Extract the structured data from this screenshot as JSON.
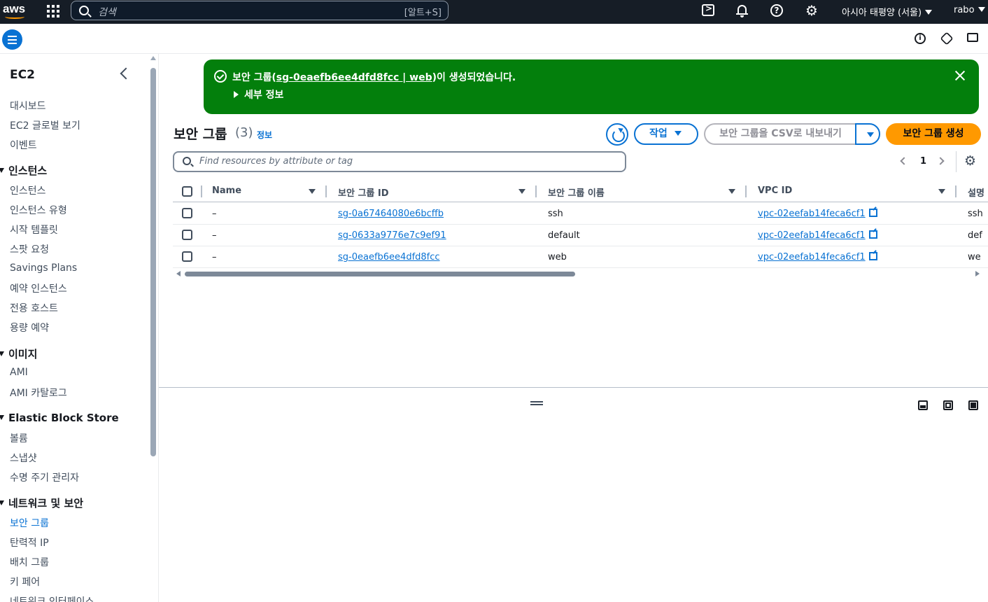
{
  "topnav": {
    "logo_text": "aws",
    "search_placeholder": "검색",
    "search_shortcut": "[알트+S]",
    "region": "아시아 태평양 (서울)",
    "user": "rabo"
  },
  "sidebar": {
    "title": "EC2",
    "items": [
      {
        "type": "item",
        "label": "대시보드"
      },
      {
        "type": "item",
        "label": "EC2 글로벌 보기"
      },
      {
        "type": "item",
        "label": "이벤트"
      },
      {
        "type": "section",
        "label": "인스턴스"
      },
      {
        "type": "item",
        "label": "인스턴스"
      },
      {
        "type": "item",
        "label": "인스턴스 유형"
      },
      {
        "type": "item",
        "label": "시작 템플릿"
      },
      {
        "type": "item",
        "label": "스팟 요청"
      },
      {
        "type": "item",
        "label": "Savings Plans"
      },
      {
        "type": "item",
        "label": "예약 인스턴스"
      },
      {
        "type": "item",
        "label": "전용 호스트"
      },
      {
        "type": "item",
        "label": "용량 예약"
      },
      {
        "type": "section",
        "label": "이미지"
      },
      {
        "type": "item",
        "label": "AMI"
      },
      {
        "type": "item",
        "label": "AMI 카탈로그"
      },
      {
        "type": "section",
        "label": "Elastic Block Store"
      },
      {
        "type": "item",
        "label": "볼륨"
      },
      {
        "type": "item",
        "label": "스냅샷"
      },
      {
        "type": "item",
        "label": "수명 주기 관리자"
      },
      {
        "type": "section",
        "label": "네트워크 및 보안"
      },
      {
        "type": "item",
        "label": "보안 그룹",
        "active": true
      },
      {
        "type": "item",
        "label": "탄력적 IP"
      },
      {
        "type": "item",
        "label": "배치 그룹"
      },
      {
        "type": "item",
        "label": "키 페어"
      },
      {
        "type": "item",
        "label": "네트워크 인터페이스"
      }
    ]
  },
  "flash": {
    "prefix": "보안 그룹(",
    "link": "sg-0eaefb6ee4dfd8fcc | web",
    "suffix": ")이 생성되었습니다.",
    "details": "세부 정보",
    "color": "#037f0c"
  },
  "header": {
    "title": "보안 그룹",
    "count": "(3)",
    "info": "정보",
    "action_label": "작업",
    "csv_label": "보안 그룹을 CSV로 내보내기",
    "create_label": "보안 그룹 생성",
    "accent": "#0972d3",
    "primary": "#ff9900"
  },
  "filter": {
    "placeholder": "Find resources by attribute or tag"
  },
  "pager": {
    "page": "1"
  },
  "table": {
    "columns": [
      "Name",
      "보안 그룹 ID",
      "보안 그룹 이름",
      "VPC ID",
      "설명"
    ],
    "rows": [
      {
        "name": "–",
        "sg_id": "sg-0a67464080e6bcffb",
        "sg_name": "ssh",
        "vpc_id": "vpc-02eefab14feca6cf1",
        "desc": "ssh"
      },
      {
        "name": "–",
        "sg_id": "sg-0633a9776e7c9ef91",
        "sg_name": "default",
        "vpc_id": "vpc-02eefab14feca6cf1",
        "desc": "def"
      },
      {
        "name": "–",
        "sg_id": "sg-0eaefb6ee4dfd8fcc",
        "sg_name": "web",
        "vpc_id": "vpc-02eefab14feca6cf1",
        "desc": "we"
      }
    ]
  }
}
